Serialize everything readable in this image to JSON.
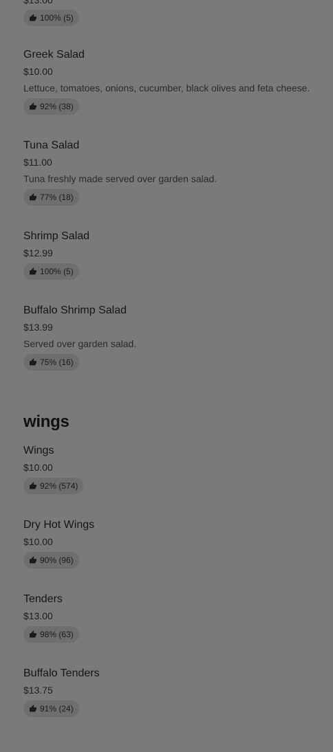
{
  "top_item": {
    "price": "$13.00",
    "rating": "100% (5)"
  },
  "salads": [
    {
      "name": "Greek Salad",
      "price": "$10.00",
      "description": "Lettuce, tomatoes, onions, cucumber, black olives and feta cheese.",
      "rating": "92% (38)"
    },
    {
      "name": "Tuna Salad",
      "price": "$11.00",
      "description": "Tuna freshly made served over garden salad.",
      "rating": "77% (18)"
    },
    {
      "name": "Shrimp Salad",
      "price": "$12.99",
      "rating": "100% (5)"
    },
    {
      "name": "Buffalo Shrimp Salad",
      "price": "$13.99",
      "description": "Served over garden salad.",
      "rating": "75% (16)"
    }
  ],
  "wings_section": {
    "title": "wings",
    "items": [
      {
        "name": "Wings",
        "price": "$10.00",
        "rating": "92% (574)"
      },
      {
        "name": "Dry Hot Wings",
        "price": "$10.00",
        "rating": "90% (96)"
      },
      {
        "name": "Tenders",
        "price": "$13.00",
        "rating": "98% (63)"
      },
      {
        "name": "Buffalo Tenders",
        "price": "$13.75",
        "rating": "91% (24)"
      }
    ]
  },
  "icons": {
    "rating_icon": "thumbs-up-icon"
  },
  "colors": {
    "overlay_background": "#7a7a7a",
    "badge_background": "#6e6e6e",
    "text": "#1a1a1a"
  }
}
